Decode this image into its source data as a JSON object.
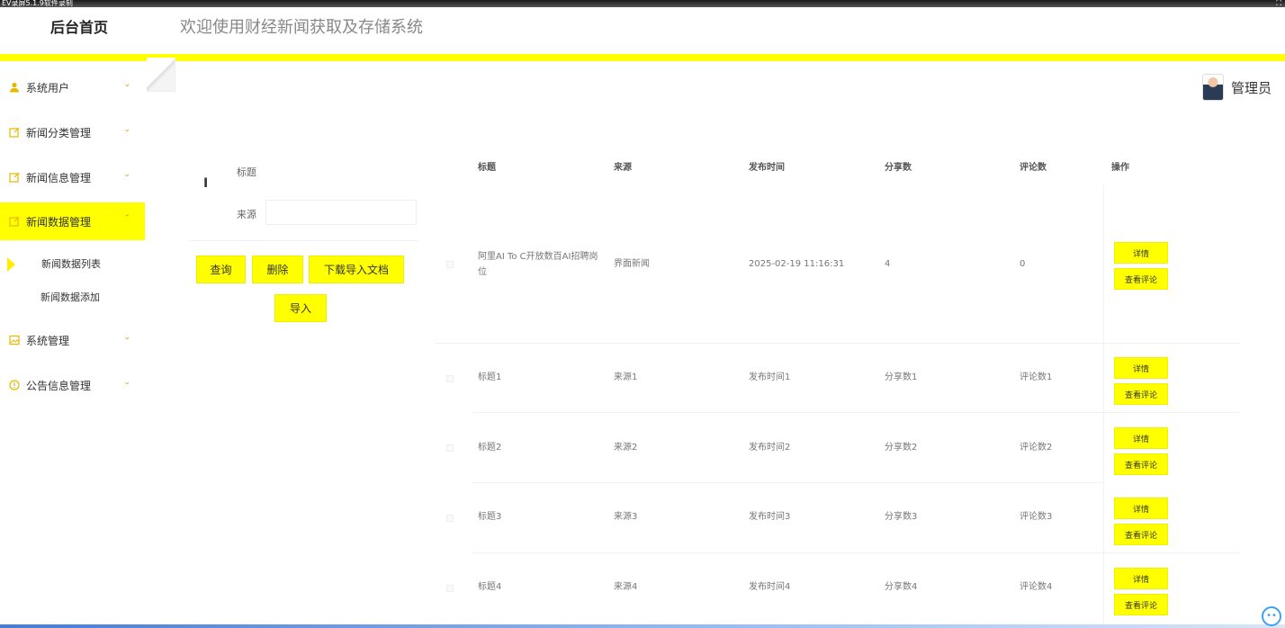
{
  "recorder": {
    "title": "EV录屏5.1.9软件录制"
  },
  "header": {
    "brand": "后台首页",
    "welcome": "欢迎使用财经新闻获取及存储系统"
  },
  "user": {
    "name": "管理员"
  },
  "sidebar": {
    "items": [
      {
        "label": "系统用户",
        "icon": "user-icon"
      },
      {
        "label": "新闻分类管理",
        "icon": "edit-icon"
      },
      {
        "label": "新闻信息管理",
        "icon": "edit-icon"
      },
      {
        "label": "新闻数据管理",
        "icon": "edit-icon",
        "active": true
      },
      {
        "label": "系统管理",
        "icon": "image-icon"
      },
      {
        "label": "公告信息管理",
        "icon": "info-icon"
      }
    ],
    "sub_items": [
      {
        "label": "新闻数据列表",
        "active": true
      },
      {
        "label": "新闻数据添加"
      }
    ]
  },
  "search": {
    "title_label": "标题",
    "source_label": "来源",
    "source_value": "",
    "buttons": {
      "query": "查询",
      "delete": "删除",
      "download": "下载导入文档",
      "import": "导入"
    }
  },
  "table": {
    "headers": [
      "标题",
      "来源",
      "发布时间",
      "分享数",
      "评论数",
      "操作"
    ],
    "rows": [
      {
        "title": "阿里AI To C开放数百AI招聘岗位",
        "source": "界面新闻",
        "time": "2025-02-19 11:16:31",
        "shares": "4",
        "comments": "0"
      },
      {
        "title": "标题1",
        "source": "来源1",
        "time": "发布时间1",
        "shares": "分享数1",
        "comments": "评论数1"
      },
      {
        "title": "标题2",
        "source": "来源2",
        "time": "发布时间2",
        "shares": "分享数2",
        "comments": "评论数2"
      },
      {
        "title": "标题3",
        "source": "来源3",
        "time": "发布时间3",
        "shares": "分享数3",
        "comments": "评论数3"
      },
      {
        "title": "标题4",
        "source": "来源4",
        "time": "发布时间4",
        "shares": "分享数4",
        "comments": "评论数4"
      }
    ],
    "actions": {
      "detail": "详情",
      "view_comments": "查看评论"
    }
  },
  "colors": {
    "accent": "#ffff00",
    "icon": "#e8b800"
  }
}
